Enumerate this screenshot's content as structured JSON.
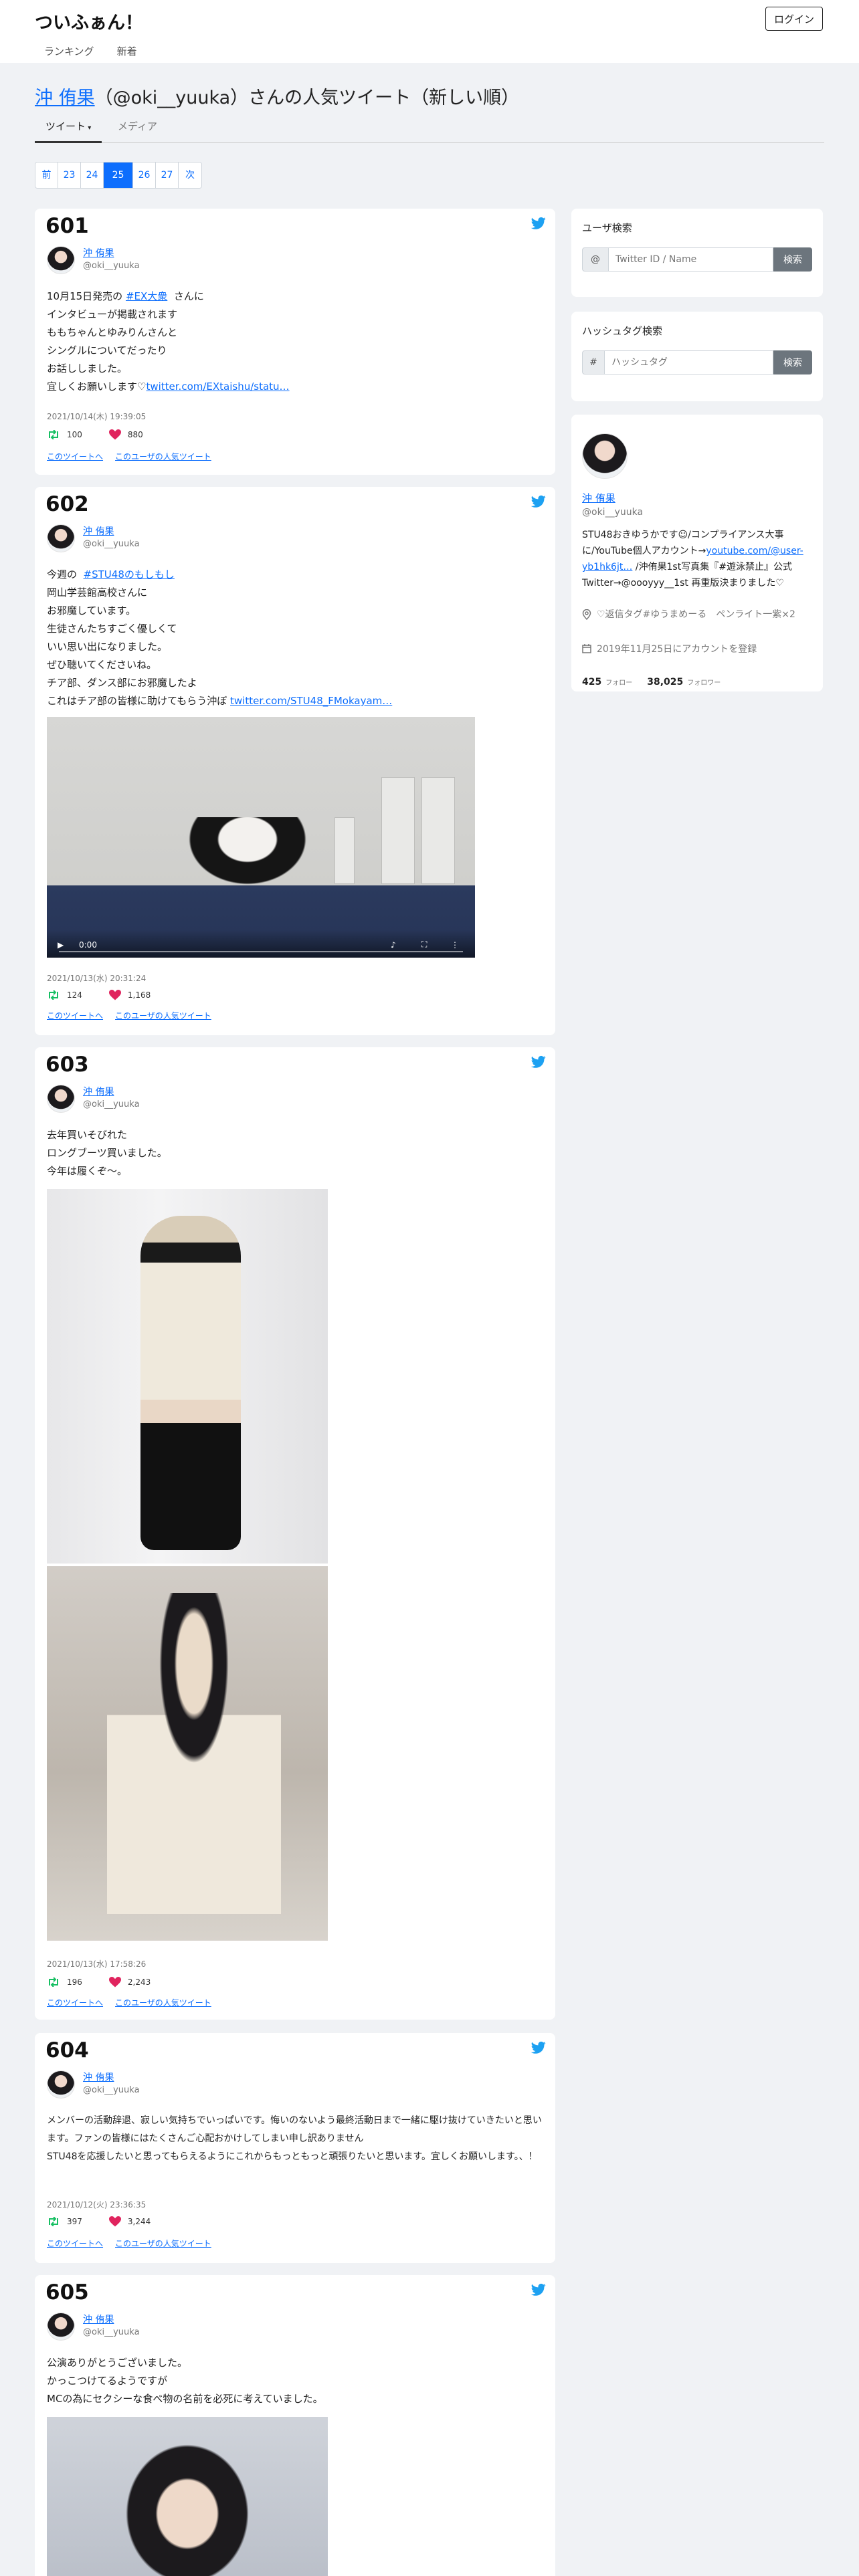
{
  "header": {
    "brand": "ついふぁん！",
    "login": "ログイン",
    "nav": [
      "ランキング",
      "新着"
    ]
  },
  "title": {
    "name": "沖 侑果",
    "rest": "（@oki__yuuka）さんの人気ツイート（新しい順）"
  },
  "tabs": [
    "ツイート",
    "メディア"
  ],
  "pager": [
    "前",
    "23",
    "24",
    "25",
    "26",
    "27",
    "次"
  ],
  "tweets": [
    {
      "num": "601",
      "user": "沖 侑果",
      "uid": "@oki__yuuka",
      "text_pre": "10月15日発売の ",
      "hashtag": "#EX大衆",
      "text_mid": "  さんに\nインタビューが掲載されます\nももちゃんとゆみりんさんと\nシングルについてだったり\nお話ししました。\n宜しくお願いします♡",
      "link": "twitter.com/EXtaishu/statu…",
      "date": "2021/10/14(木) 19:39:05",
      "rt": "100",
      "likes": "880",
      "link1": "このツイートへ",
      "link2": "このユーザの人気ツイート"
    },
    {
      "num": "602",
      "user": "沖 侑果",
      "uid": "@oki__yuuka",
      "text_pre": "今週の  ",
      "hashtag": "#STU48のもしもし",
      "text_mid": "\n岡山学芸館高校さんに\nお邪魔しています。\n生徒さんたちすごく優しくて\nいい思い出になりました。\nぜひ聴いてくださいね。\nチア部、ダンス部にお邪魔したよ\nこれはチア部の皆様に助けてもらう沖ぼ ",
      "link": "twitter.com/STU48_FMokayam…",
      "video_time": "0:00",
      "date": "2021/10/13(水) 20:31:24",
      "rt": "124",
      "likes": "1,168",
      "link1": "このツイートへ",
      "link2": "このユーザの人気ツイート"
    },
    {
      "num": "603",
      "user": "沖 侑果",
      "uid": "@oki__yuuka",
      "text": "去年買いそびれた\nロングブーツ買いました。\n今年は履くぞ〜。",
      "date": "2021/10/13(水) 17:58:26",
      "rt": "196",
      "likes": "2,243",
      "link1": "このツイートへ",
      "link2": "このユーザの人気ツイート"
    },
    {
      "num": "604",
      "user": "沖 侑果",
      "uid": "@oki__yuuka",
      "text": "メンバーの活動辞退、寂しい気持ちでいっぱいです。悔いのないよう最終活動日まで一緒に駆け抜けていきたいと思います。ファンの皆様にはたくさんご心配おかけしてしまい申し訳ありません\nSTU48を応援したいと思ってもらえるようにこれからもっともっと頑張りたいと思います。宜しくお願いします。、！",
      "date": "2021/10/12(火) 23:36:35",
      "rt": "397",
      "likes": "3,244",
      "link1": "このツイートへ",
      "link2": "このユーザの人気ツイート"
    },
    {
      "num": "605",
      "user": "沖 侑果",
      "uid": "@oki__yuuka",
      "text": "公演ありがとうございました。\nかっこつけてるようですが\nMCの為にセクシーな食べ物の名前を必死に考えていました。"
    }
  ],
  "sidebar": {
    "user_search": {
      "title": "ユーザ検索",
      "prefix": "@",
      "placeholder": "Twitter ID / Name",
      "button": "検索"
    },
    "tag_search": {
      "title": "ハッシュタグ検索",
      "prefix": "#",
      "placeholder": "ハッシュタグ",
      "button": "検索"
    },
    "profile": {
      "name": "沖 侑果",
      "id": "@oki__yuuka",
      "bio_pre": "STU48おきゆうかです☺︎/コンプライアンス大事に/YouTube個人アカウント→",
      "bio_link": "youtube.com/@user-yb1hk6jt…",
      "bio_post": " /沖侑果1st写真集『#遊泳禁止』公式Twitter→@oooyyy__1st 再重版決まりました♡",
      "location": "♡返信タグ#ゆうまめーる　ペンライト一紫×2",
      "joined": "2019年11月25日にアカウントを登録",
      "following": "425",
      "following_label": "フォロー",
      "followers": "38,025",
      "followers_label": "フォロワー"
    }
  },
  "colors": {
    "accent": "#0d6efd",
    "retweet": "#17bf63",
    "like": "#e0245e",
    "twitter": "#1da1f2"
  }
}
